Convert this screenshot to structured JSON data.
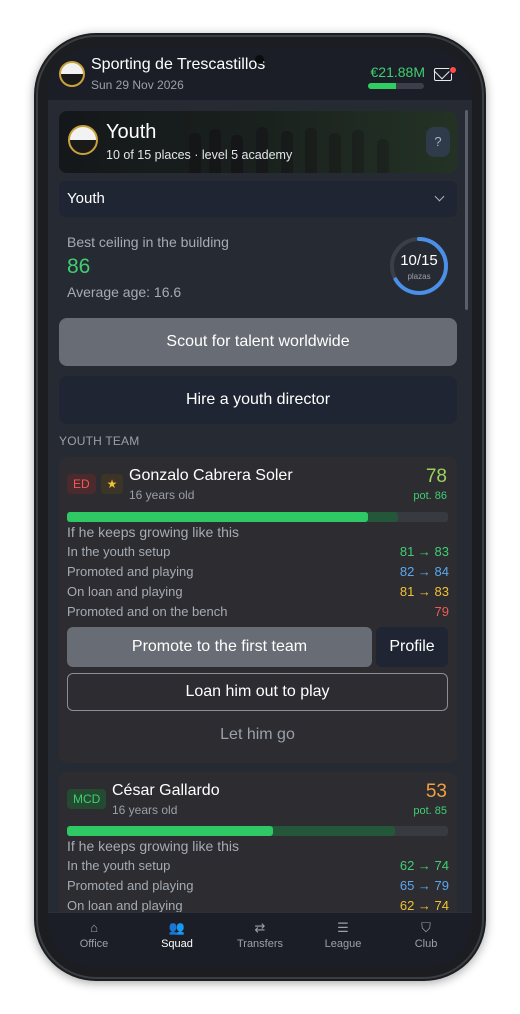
{
  "header": {
    "club_name": "Sporting de Trescastillos",
    "date": "Sun 29 Nov 2026",
    "balance": "€21.88M",
    "balance_level": 0.5,
    "mail_icon": "mail-icon"
  },
  "banner": {
    "title": "Youth",
    "subtitle": "10 of 15 places · level 5 academy",
    "help_label": "?"
  },
  "view_select": {
    "value": "Youth",
    "icon": "chevron-down-icon"
  },
  "summary": {
    "best_ceiling_label": "Best ceiling in the building",
    "best_ceiling_value": "86",
    "average_age": "Average age: 16.6",
    "places_count": "10/15",
    "places_unit": "plazas",
    "places_filled": 10,
    "places_total": 15
  },
  "actions": {
    "scout": "Scout for talent worldwide",
    "hire": "Hire a youth director"
  },
  "section_title": "YOUTH TEAM",
  "players": [
    {
      "position": "ED",
      "starred": true,
      "name": "Gonzalo Cabrera Soler",
      "age": "16 years old",
      "rating": "78",
      "potential": "pot. 86",
      "current_level": 0.79,
      "potential_level": 0.87,
      "growth_heading": "If he keeps growing like this",
      "projections": [
        {
          "label": "In the youth setup",
          "value": "81 → 83",
          "color": "#3fcf70"
        },
        {
          "label": "Promoted and playing",
          "value": "82 → 84",
          "color": "#5aa8f0"
        },
        {
          "label": "On loan and playing",
          "value": "81 → 83",
          "color": "#f2c232"
        },
        {
          "label": "Promoted and on the bench",
          "value": "79",
          "color": "#ee5a5a"
        }
      ],
      "promote": "Promote to the first team",
      "profile": "Profile",
      "loan": "Loan him out to play",
      "release": "Let him go"
    },
    {
      "position": "MCD",
      "starred": false,
      "name": "César Gallardo",
      "age": "16 years old",
      "rating": "53",
      "potential": "pot. 85",
      "current_level": 0.54,
      "potential_level": 0.86,
      "growth_heading": "If he keeps growing like this",
      "projections": [
        {
          "label": "In the youth setup",
          "value": "62 → 74",
          "color": "#3fcf70"
        },
        {
          "label": "Promoted and playing",
          "value": "65 → 79",
          "color": "#5aa8f0"
        },
        {
          "label": "On loan and playing",
          "value": "62 → 74",
          "color": "#f2c232"
        }
      ]
    }
  ],
  "nav": [
    {
      "label": "Office",
      "icon": "home-icon",
      "glyph": "⌂",
      "active": false
    },
    {
      "label": "Squad",
      "icon": "squad-icon",
      "glyph": "👥",
      "active": true
    },
    {
      "label": "Transfers",
      "icon": "transfers-icon",
      "glyph": "⇄",
      "active": false
    },
    {
      "label": "League",
      "icon": "list-icon",
      "glyph": "☰",
      "active": false
    },
    {
      "label": "Club",
      "icon": "shield-icon",
      "glyph": "⛉",
      "active": false
    }
  ],
  "colors": {
    "accent_green": "#3fcf70",
    "blue": "#5aa8f0",
    "yellow": "#f2c232",
    "red": "#ee5a5a",
    "orange": "#f0a040"
  }
}
